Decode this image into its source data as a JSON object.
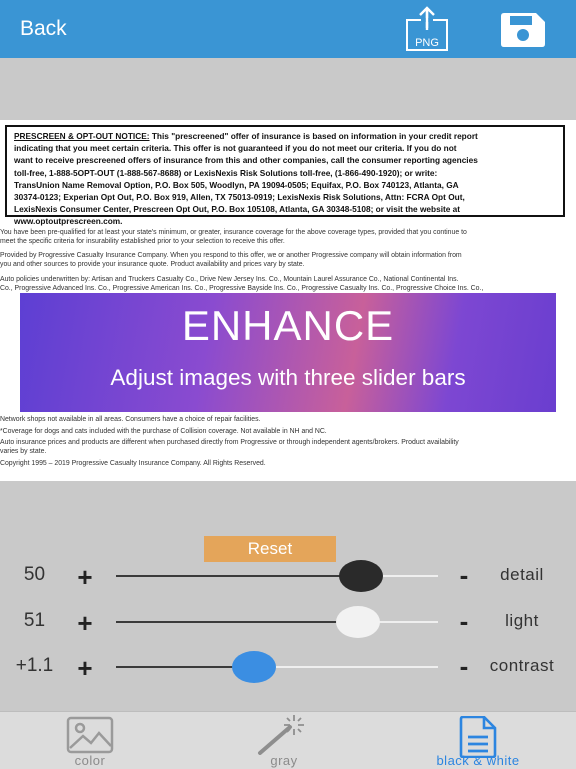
{
  "header": {
    "back_label": "Back",
    "png_label": "PNG"
  },
  "document": {
    "notice_title": "PRESCREEN & OPT-OUT NOTICE:",
    "notice_lines": [
      " This \"prescreened\" offer of insurance is based on information in your credit report",
      "indicating that you meet certain criteria. This offer is not guaranteed if you do not meet our criteria. If you do not",
      "want to receive prescreened offers of insurance from this and other companies, call the consumer reporting agencies",
      "toll-free, 1-888-5OPT-OUT (1-888-567-8688) or LexisNexis Risk Solutions toll-free, (1-866-490-1920); or write:",
      "TransUnion Name Removal Option, P.O. Box 505, Woodlyn, PA 19094-0505; Equifax, P.O. Box 740123, Atlanta, GA",
      "30374-0123; Experian Opt Out, P.O. Box 919, Allen, TX 75013-0919; LexisNexis Risk Solutions, Attn: FCRA Opt Out,",
      "LexisNexis Consumer Center, Prescreen Opt Out, P.O. Box 105108, Atlanta, GA 30348-5108; or visit the website at",
      "www.optoutprescreen.com."
    ],
    "para1": [
      "You have been pre-qualified for at least your state's minimum, or greater, insurance coverage for the above coverage types, provided that you continue to",
      "meet the specific criteria for insurability established prior to your selection to receive this offer."
    ],
    "para2": [
      "Provided by Progressive Casualty Insurance Company. When you respond to this offer, we or another Progressive company will obtain information from",
      "you and other sources to provide your insurance quote. Product availability and prices vary by state."
    ],
    "para3": [
      "Auto policies underwritten by: Artisan and Truckers Casualty Co., Drive New Jersey Ins. Co., Mountain Laurel Assurance Co., National Continental Ins.",
      "Co., Progressive Advanced Ins. Co., Progressive American Ins. Co., Progressive Bayside Ins. Co., Progressive Casualty Ins. Co., Progressive Choice Ins. Co.,"
    ],
    "para4": [
      "Network shops not available in all areas. Consumers have a choice of repair facilities.",
      "*Coverage for dogs and cats included with the purchase of Collision coverage. Not available in NH and NC.",
      "Auto insurance prices and products are different when purchased directly from Progressive or through independent agents/brokers. Product availability",
      "varies by state.",
      "Copyright 1995 – 2019 Progressive Casualty Insurance Company. All Rights Reserved."
    ]
  },
  "banner": {
    "title": "ENHANCE",
    "subtitle": "Adjust images with three slider bars"
  },
  "controls": {
    "reset_label": "Reset",
    "plus_symbol": "+",
    "minus_symbol": "-",
    "sliders": [
      {
        "value_label": "50",
        "name": "detail",
        "position": 0.76,
        "knob_color": "#2a2a2a"
      },
      {
        "value_label": "51",
        "name": "light",
        "position": 0.75,
        "knob_color": "#f2f2f2"
      },
      {
        "value_label": "+1.1",
        "name": "contrast",
        "position": 0.43,
        "knob_color": "#3b8ee2"
      }
    ]
  },
  "tabs": [
    {
      "label": "color",
      "icon": "image-icon",
      "active": false
    },
    {
      "label": "gray",
      "icon": "magic-wand-icon",
      "active": false
    },
    {
      "label": "black & white",
      "icon": "document-icon",
      "active": true
    }
  ],
  "colors": {
    "accent": "#3a95d4",
    "reset": "#e4a55a",
    "active_tab": "#2c85e0"
  }
}
